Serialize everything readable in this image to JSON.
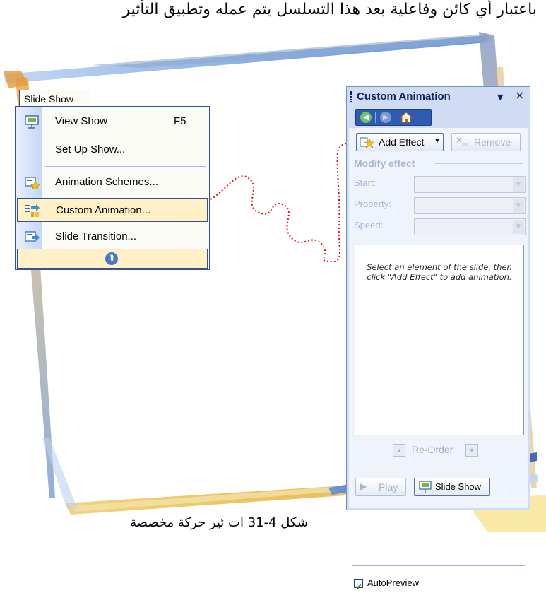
{
  "header_text": "باعتبار أي كائن وفاعلية بعد هذا التسلسل يتم عمله وتطبيق التأثير",
  "caption": "شكل 4-31 ات ئير حركة مخصصة",
  "menu": {
    "title": "Slide Show",
    "items": [
      {
        "label": "View Show",
        "shortcut": "F5",
        "icon": "projector-screen-icon"
      },
      {
        "label": "Set Up Show...",
        "shortcut": "",
        "icon": ""
      },
      {
        "label": "Animation Schemes...",
        "shortcut": "",
        "icon": "animation-schemes-icon"
      },
      {
        "label": "Custom Animation...",
        "shortcut": "",
        "icon": "custom-animation-icon"
      },
      {
        "label": "Slide Transition...",
        "shortcut": "",
        "icon": "slide-transition-icon"
      }
    ],
    "expand_icon": "double-chevron-down-icon"
  },
  "pane": {
    "title": "Custom Animation",
    "add_effect": "Add Effect",
    "remove": "Remove",
    "modify_section": "Modify effect",
    "start_label": "Start:",
    "property_label": "Property:",
    "speed_label": "Speed:",
    "hint": "Select an element of the slide, then click \"Add Effect\" to add animation.",
    "reorder": "Re-Order",
    "play": "Play",
    "slide_show": "Slide Show",
    "autopreview": "AutoPreview",
    "autopreview_checked": true
  },
  "colors": {
    "pane_title": "#0b2467",
    "highlight": "#fff0c8",
    "menu_border": "#33558a",
    "dotted_connector": "#e0141e"
  }
}
